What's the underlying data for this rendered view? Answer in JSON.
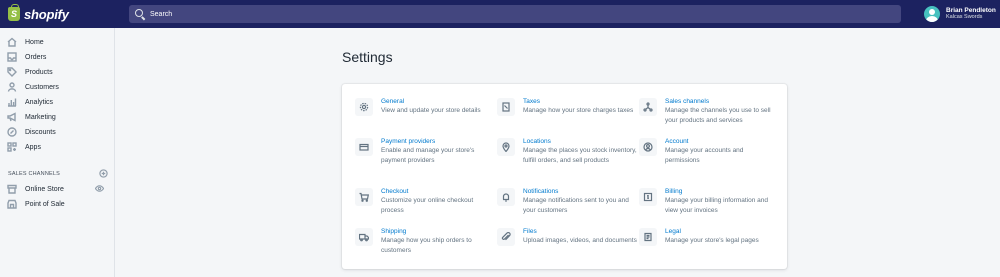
{
  "header": {
    "brand_name": "shopify",
    "brand_mark": "S",
    "search_placeholder": "Search",
    "user_name": "Brian Pendleton",
    "store_name": "Kalcas Swords"
  },
  "sidebar": {
    "items": [
      {
        "label": "Home",
        "icon": "home-icon"
      },
      {
        "label": "Orders",
        "icon": "orders-icon"
      },
      {
        "label": "Products",
        "icon": "tag-icon"
      },
      {
        "label": "Customers",
        "icon": "person-icon"
      },
      {
        "label": "Analytics",
        "icon": "bar-chart-icon"
      },
      {
        "label": "Marketing",
        "icon": "megaphone-icon"
      },
      {
        "label": "Discounts",
        "icon": "discount-icon"
      },
      {
        "label": "Apps",
        "icon": "apps-icon"
      }
    ],
    "section_title": "SALES CHANNELS",
    "channels": [
      {
        "label": "Online Store",
        "icon": "store-icon"
      },
      {
        "label": "Point of Sale",
        "icon": "pos-icon"
      }
    ]
  },
  "main": {
    "title": "Settings",
    "tiles": [
      {
        "title": "General",
        "desc": "View and update your store details",
        "icon": "gear-icon"
      },
      {
        "title": "Taxes",
        "desc": "Manage how your store charges taxes",
        "icon": "receipt-icon"
      },
      {
        "title": "Sales channels",
        "desc": "Manage the channels you use to sell your products and services",
        "icon": "channels-icon"
      },
      {
        "title": "Payment providers",
        "desc": "Enable and manage your store's payment providers",
        "icon": "credit-card-icon"
      },
      {
        "title": "Locations",
        "desc": "Manage the places you stock inventory, fulfill orders, and sell products",
        "icon": "location-pin-icon"
      },
      {
        "title": "Account",
        "desc": "Manage your accounts and permissions",
        "icon": "account-icon"
      },
      {
        "title": "Checkout",
        "desc": "Customize your online checkout process",
        "icon": "cart-icon"
      },
      {
        "title": "Notifications",
        "desc": "Manage notifications sent to you and your customers",
        "icon": "bell-icon"
      },
      {
        "title": "Billing",
        "desc": "Manage your billing information and view your invoices",
        "icon": "billing-icon"
      },
      {
        "title": "Shipping",
        "desc": "Manage how you ship orders to customers",
        "icon": "truck-icon"
      },
      {
        "title": "Files",
        "desc": "Upload images, videos, and documents",
        "icon": "paperclip-icon"
      },
      {
        "title": "Legal",
        "desc": "Manage your store's legal pages",
        "icon": "legal-icon"
      }
    ]
  }
}
